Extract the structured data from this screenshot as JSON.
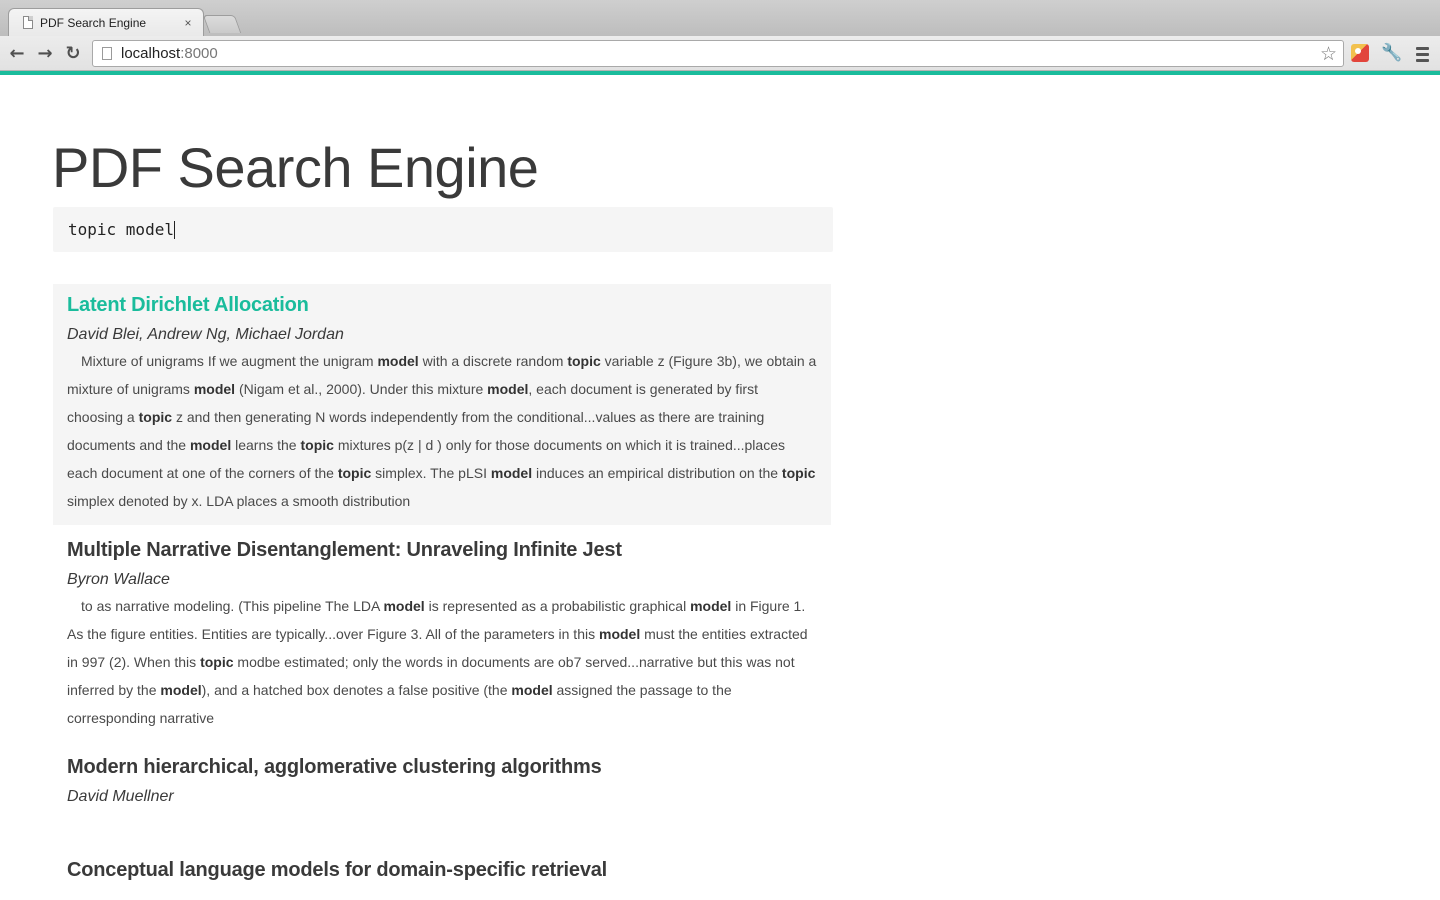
{
  "browser": {
    "tab_title": "PDF Search Engine",
    "tab_close": "×",
    "url_host": "localhost",
    "url_port": ":8000",
    "back_glyph": "←",
    "forward_glyph": "→",
    "reload_glyph": "↻",
    "star_glyph": "☆",
    "wrench_glyph": "🔧",
    "accent_color": "#1abc9c"
  },
  "page": {
    "title": "PDF Search Engine",
    "search": {
      "value": "topic model",
      "placeholder": ""
    }
  },
  "results": [
    {
      "title": "Latent Dirichlet Allocation",
      "authors": "David Blei, Andrew Ng, Michael Jordan",
      "active": true,
      "snippet": [
        {
          "t": "Mixture of unigrams If we augment the unigram "
        },
        {
          "b": "model"
        },
        {
          "t": " with a discrete random "
        },
        {
          "b": "topic"
        },
        {
          "t": " variable z (Figure 3b), we obtain a mixture of unigrams "
        },
        {
          "b": "model"
        },
        {
          "t": " (Nigam et al., 2000). Under this mixture "
        },
        {
          "b": "model"
        },
        {
          "t": ", each document is generated by first choosing a "
        },
        {
          "b": "topic"
        },
        {
          "t": " z and then generating N words independently from the conditional...values as there are training documents and the "
        },
        {
          "b": "model"
        },
        {
          "t": " learns the "
        },
        {
          "b": "topic"
        },
        {
          "t": " mixtures p(z | d ) only for those documents on which it is trained...places each document at one of the corners of the "
        },
        {
          "b": "topic"
        },
        {
          "t": " simplex. The pLSI "
        },
        {
          "b": "model"
        },
        {
          "t": " induces an empirical distribution on the "
        },
        {
          "b": "topic"
        },
        {
          "t": " simplex denoted by x. LDA places a smooth distribution"
        }
      ]
    },
    {
      "title": "Multiple Narrative Disentanglement: Unraveling Infinite Jest",
      "authors": "Byron Wallace",
      "active": false,
      "snippet": [
        {
          "t": "to as narrative modeling. (This pipeline The LDA "
        },
        {
          "b": "model"
        },
        {
          "t": " is represented as a probabilistic graphical "
        },
        {
          "b": "model"
        },
        {
          "t": " in Figure 1. As the figure entities. Entities are typically...over Figure 3. All of the parameters in this "
        },
        {
          "b": "model"
        },
        {
          "t": " must the entities extracted in 997 (2). When this "
        },
        {
          "b": "topic"
        },
        {
          "t": " modbe estimated; only the words in documents are ob7 served...narrative but this was not inferred by the "
        },
        {
          "b": "model"
        },
        {
          "t": "), and a hatched box denotes a false positive (the "
        },
        {
          "b": "model"
        },
        {
          "t": " assigned the passage to the corresponding narrative"
        }
      ]
    },
    {
      "title": "Modern hierarchical, agglomerative clustering algorithms",
      "authors": "David Muellner",
      "active": false,
      "snippet": []
    },
    {
      "title": "Conceptual language models for domain-specific retrieval",
      "authors": "",
      "active": false,
      "snippet": []
    }
  ]
}
